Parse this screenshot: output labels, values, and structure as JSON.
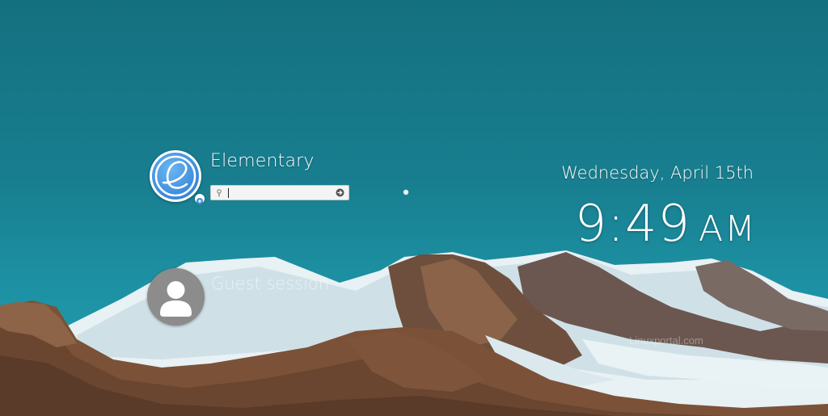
{
  "user": {
    "name": "Elementary",
    "avatar_icon": "elementary-logo-icon",
    "session_icon": "session-type-icon",
    "password_value": "",
    "lock_icon": "key-icon",
    "submit_icon": "arrow-right-icon"
  },
  "guest": {
    "label": "Guest session",
    "avatar_icon": "person-icon"
  },
  "clock": {
    "date": "Wednesday, April 15th",
    "time": "9:49",
    "ampm": "AM"
  },
  "watermark": {
    "text": "Linuxportal.com"
  },
  "colors": {
    "sky_top": "#14707f",
    "sky_bottom": "#23a1b4",
    "elementary_blue": "#3f8fdd",
    "guest_avatar": "#8c8c8c"
  }
}
